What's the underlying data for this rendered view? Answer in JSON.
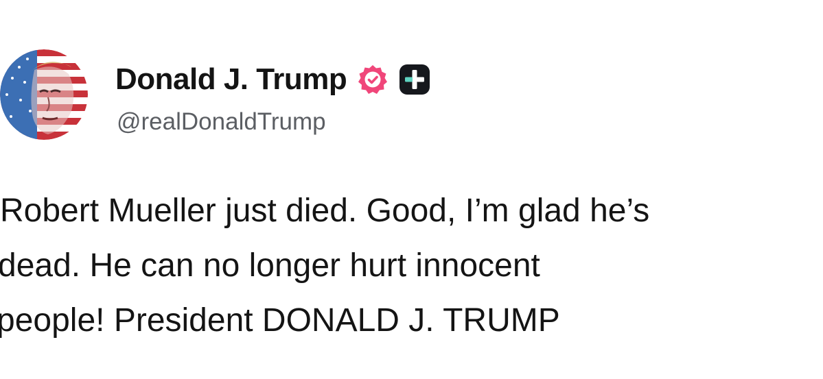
{
  "profile": {
    "display_name": "Donald J. Trump",
    "handle": "@realDonaldTrump",
    "verified_icon": "verified-badge-icon",
    "plus_icon": "plus-badge-icon",
    "verified_color": "#f0467a",
    "plus_badge_color": "#16181d"
  },
  "post": {
    "lines": [
      "Robert Mueller just died. Good, I’m glad he’s",
      "dead. He can no longer hurt innocent",
      "people! President DONALD J. TRUMP"
    ]
  }
}
